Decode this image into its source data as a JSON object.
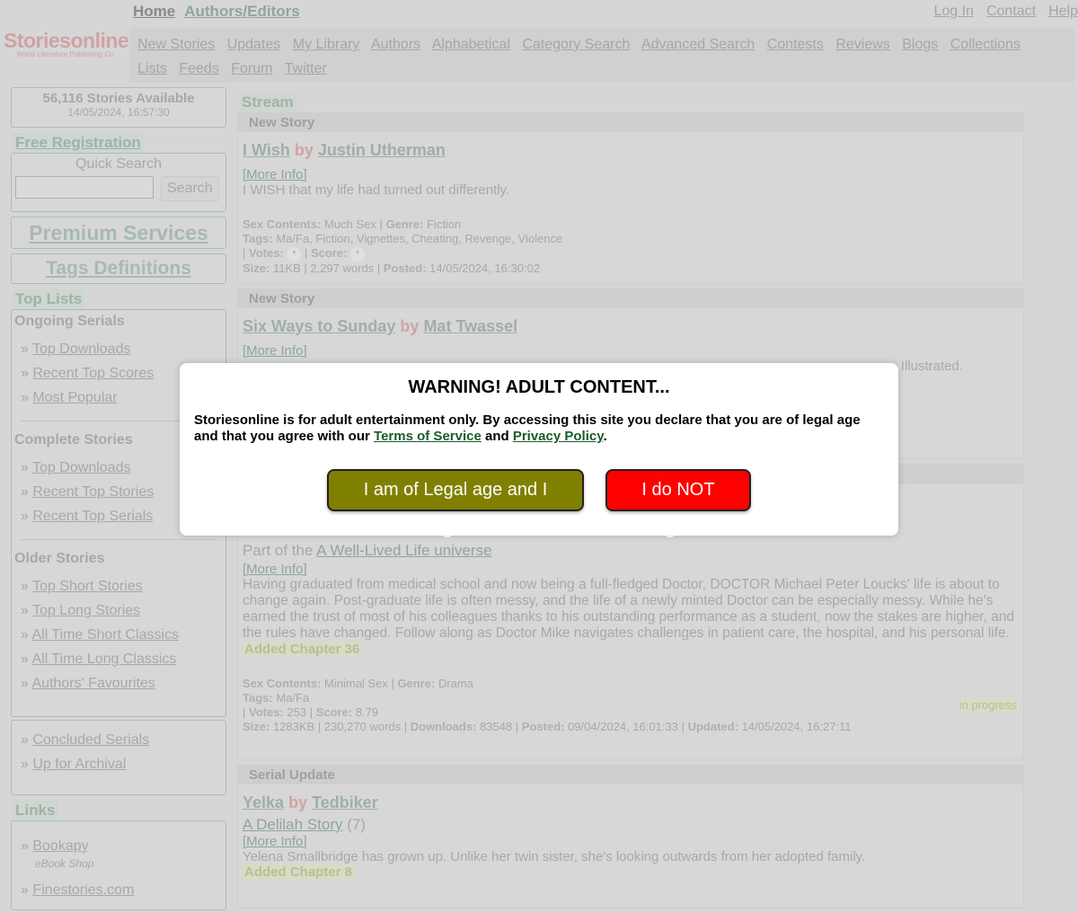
{
  "header": {
    "logo": "Storiesonline",
    "logo_sub": "World Literature Publishing Co.",
    "top_links": [
      "Home",
      "Authors/Editors"
    ],
    "right_links": [
      "Log In",
      "Contact",
      "Help"
    ],
    "nav": [
      "New Stories",
      "Updates",
      "My Library",
      "Authors",
      "Alphabetical",
      "Category Search",
      "Advanced Search",
      "Contests",
      "Reviews",
      "Blogs",
      "Collections",
      "Lists",
      "Feeds",
      "Forum",
      "Twitter"
    ]
  },
  "sidebar": {
    "count": "56,116 Stories Available",
    "datetime": "14/05/2024, 16:57:30",
    "free_registration": "Free Registration",
    "quick_search": "Quick Search",
    "search_value": "",
    "search_button": "Search",
    "premium": "Premium Services",
    "tags": "Tags Definitions",
    "top_lists": "Top Lists",
    "ongoing": {
      "title": "Ongoing Serials",
      "items": [
        "Top Downloads",
        "Recent Top Scores",
        "Most Popular"
      ]
    },
    "complete": {
      "title": "Complete Stories",
      "items": [
        "Top Downloads",
        "Recent Top Stories",
        "Recent Top Serials"
      ]
    },
    "older": {
      "title": "Older Stories",
      "items": [
        "Top Short Stories",
        "Top Long Stories",
        "All Time Short Classics",
        "All Time Long Classics",
        "Authors' Favourites"
      ]
    },
    "misc": [
      "Concluded Serials",
      "Up for Archival"
    ],
    "links_title": "Links",
    "links": [
      {
        "label": "Bookapy",
        "sub": "eBook Shop"
      },
      {
        "label": "Finestories.com"
      }
    ]
  },
  "main": {
    "stream": "Stream",
    "more_info": "[More Info]",
    "by": "by",
    "s1": {
      "type": "New Story",
      "title": "I Wish",
      "author": "Justin Utherman",
      "desc": "I WISH that my life had turned out differently.",
      "sex": "Much Sex",
      "genre": "Fiction",
      "tags": "Ma/Fa, Fiction, Vignettes, Cheating, Revenge, Violence",
      "votes": "*",
      "score": "*",
      "size": "11KB",
      "words": "2,297 words",
      "posted": "14/05/2024, 16:30:02"
    },
    "s2": {
      "type": "New Story",
      "title": "Six Ways to Sunday",
      "author": "Mat Twassel",
      "desc_tail": "Illustrated."
    },
    "s3": {
      "part_of": "Part of the",
      "universe": "A Well-Lived Life universe",
      "desc": "Having graduated from medical school and now being a full-fledged Doctor, DOCTOR Michael Peter Loucks' life is about to change again. Post-graduate life is often messy, and the life of a newly minted Doctor can be especially messy. While he's earned the trust of most of his colleagues thanks to his outstanding performance as a student, now the stakes are higher, and the rules have changed. Follow along as Doctor Mike navigates challenges in patient care, the hospital, and his personal life.",
      "added": "Added Chapter 36",
      "status": "in progress",
      "sex": "Minimal Sex",
      "genre": "Drama",
      "tags": "Ma/Fa",
      "votes": "253",
      "score": "8.79",
      "size": "1283KB",
      "words": "230,270 words",
      "downloads": "83548",
      "posted": "09/04/2024, 16:01:33",
      "updated": "14/05/2024, 16:27:11"
    },
    "s4": {
      "type": "Serial Update",
      "title": "Yelka",
      "author": "Tedbiker",
      "series": "A Delilah Story",
      "series_count": "(7)",
      "desc": "Yelena Smallbridge has grown up. Unlike her twin sister, she's looking outwards from her adopted family.",
      "added": "Added Chapter 8"
    },
    "labels": {
      "sex": "Sex Contents:",
      "genre": "Genre:",
      "tags": "Tags:",
      "votes": "Votes:",
      "score": "Score:",
      "size": "Size:",
      "downloads": "Downloads:",
      "posted": "Posted:",
      "updated": "Updated:"
    }
  },
  "modal": {
    "title": "WARNING! ADULT CONTENT...",
    "text1": "Storiesonline is for adult entertainment only. By accessing this site you declare that you are of legal age and that you agree with our",
    "tos": "Terms of Service",
    "and": "and",
    "privacy": "Privacy Policy",
    "agree": "I am of Legal age and I agree",
    "disagree": "I do NOT agree",
    "agree_color": "#808000",
    "disagree_color": "#ff0000"
  }
}
